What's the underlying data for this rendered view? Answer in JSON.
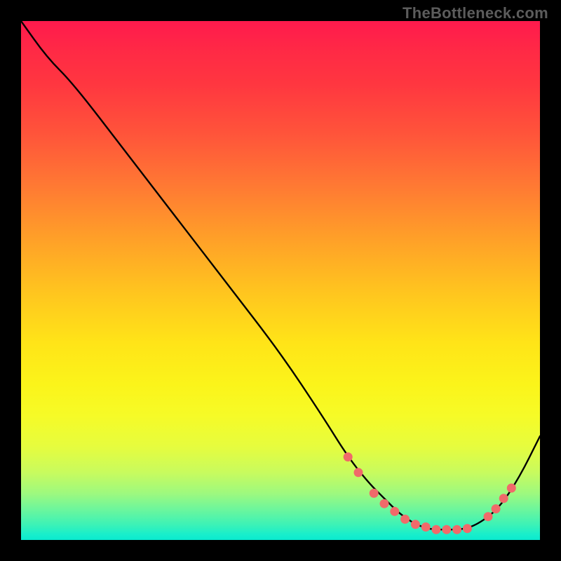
{
  "watermark": "TheBottleneck.com",
  "chart_data": {
    "type": "line",
    "title": "",
    "xlabel": "",
    "ylabel": "",
    "xlim": [
      0,
      100
    ],
    "ylim": [
      0,
      100
    ],
    "grid": false,
    "legend": false,
    "series": [
      {
        "name": "curve",
        "x": [
          0,
          5,
          10,
          20,
          30,
          40,
          50,
          58,
          63,
          67,
          70,
          73,
          76,
          79,
          82,
          85,
          88,
          92,
          96,
          100
        ],
        "y": [
          100,
          93,
          88,
          75,
          62,
          49,
          36,
          24,
          16,
          11,
          8,
          5,
          3,
          2,
          2,
          2,
          3,
          6,
          12,
          20
        ]
      }
    ],
    "markers": {
      "name": "dots",
      "color": "#f06a6a",
      "x": [
        63,
        65,
        68,
        70,
        72,
        74,
        76,
        78,
        80,
        82,
        84,
        86,
        90,
        91.5,
        93,
        94.5
      ],
      "y": [
        16,
        13,
        9,
        7,
        5.5,
        4,
        3,
        2.5,
        2,
        2,
        2,
        2.2,
        4.5,
        6,
        8,
        10
      ]
    },
    "gradient_stops": [
      {
        "pos": 0.0,
        "color": "#ff1a4d"
      },
      {
        "pos": 0.22,
        "color": "#ff553a"
      },
      {
        "pos": 0.52,
        "color": "#ffc41f"
      },
      {
        "pos": 0.76,
        "color": "#f6fb27"
      },
      {
        "pos": 0.94,
        "color": "#6ef69b"
      },
      {
        "pos": 1.0,
        "color": "#0aeacf"
      }
    ]
  }
}
